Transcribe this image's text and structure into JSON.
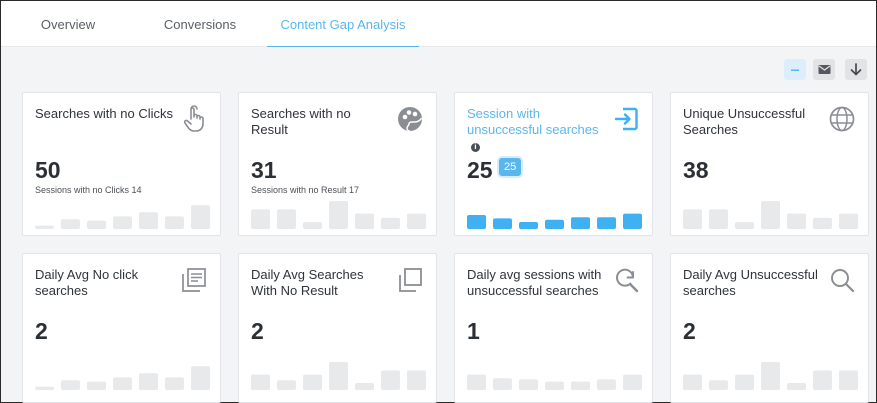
{
  "tabs": [
    {
      "label": "Overview"
    },
    {
      "label": "Conversions"
    },
    {
      "label": "Content Gap Analysis"
    }
  ],
  "colors": {
    "accent": "#5ab7ee",
    "bar_muted": "#e8e9eb",
    "bar_active": "#3fb1f2"
  },
  "cards": [
    {
      "title": "Searches with no Clicks",
      "value": "50",
      "sub": "Sessions with no Clicks 14",
      "icon": "touch-icon",
      "bars": [
        0.12,
        0.35,
        0.3,
        0.45,
        0.6,
        0.45,
        0.85
      ]
    },
    {
      "title": "Searches with no Result",
      "value": "31",
      "sub": "Sessions with no Result 17",
      "icon": "palette-icon",
      "bars": [
        0.7,
        0.7,
        0.25,
        1.0,
        0.55,
        0.4,
        0.55
      ]
    },
    {
      "title": "Session with unsuccessful searches",
      "value": "25",
      "badge": "25",
      "icon": "login-box-icon",
      "bars": [
        0.5,
        0.38,
        0.25,
        0.33,
        0.42,
        0.42,
        0.55
      ]
    },
    {
      "title": "Unique Unsuccessful Searches",
      "value": "38",
      "icon": "globe-icon",
      "bars": [
        0.7,
        0.7,
        0.25,
        1.0,
        0.55,
        0.4,
        0.55
      ]
    },
    {
      "title": "Daily Avg No click searches",
      "value": "2",
      "icon": "article-list-icon",
      "bars": [
        0.12,
        0.35,
        0.3,
        0.45,
        0.6,
        0.45,
        0.85
      ]
    },
    {
      "title": "Daily Avg Searches With No Result",
      "value": "2",
      "icon": "copy-squares-icon",
      "bars": [
        0.55,
        0.35,
        0.55,
        1.0,
        0.25,
        0.7,
        0.7
      ]
    },
    {
      "title": "Daily avg sessions with unsuccessful searches",
      "value": "1",
      "icon": "search-refresh-icon",
      "bars": [
        0.55,
        0.42,
        0.38,
        0.3,
        0.3,
        0.38,
        0.55
      ]
    },
    {
      "title": "Daily Avg Unsuccessful searches",
      "value": "2",
      "icon": "search-icon",
      "bars": [
        0.55,
        0.35,
        0.55,
        1.0,
        0.25,
        0.7,
        0.7
      ]
    }
  ]
}
